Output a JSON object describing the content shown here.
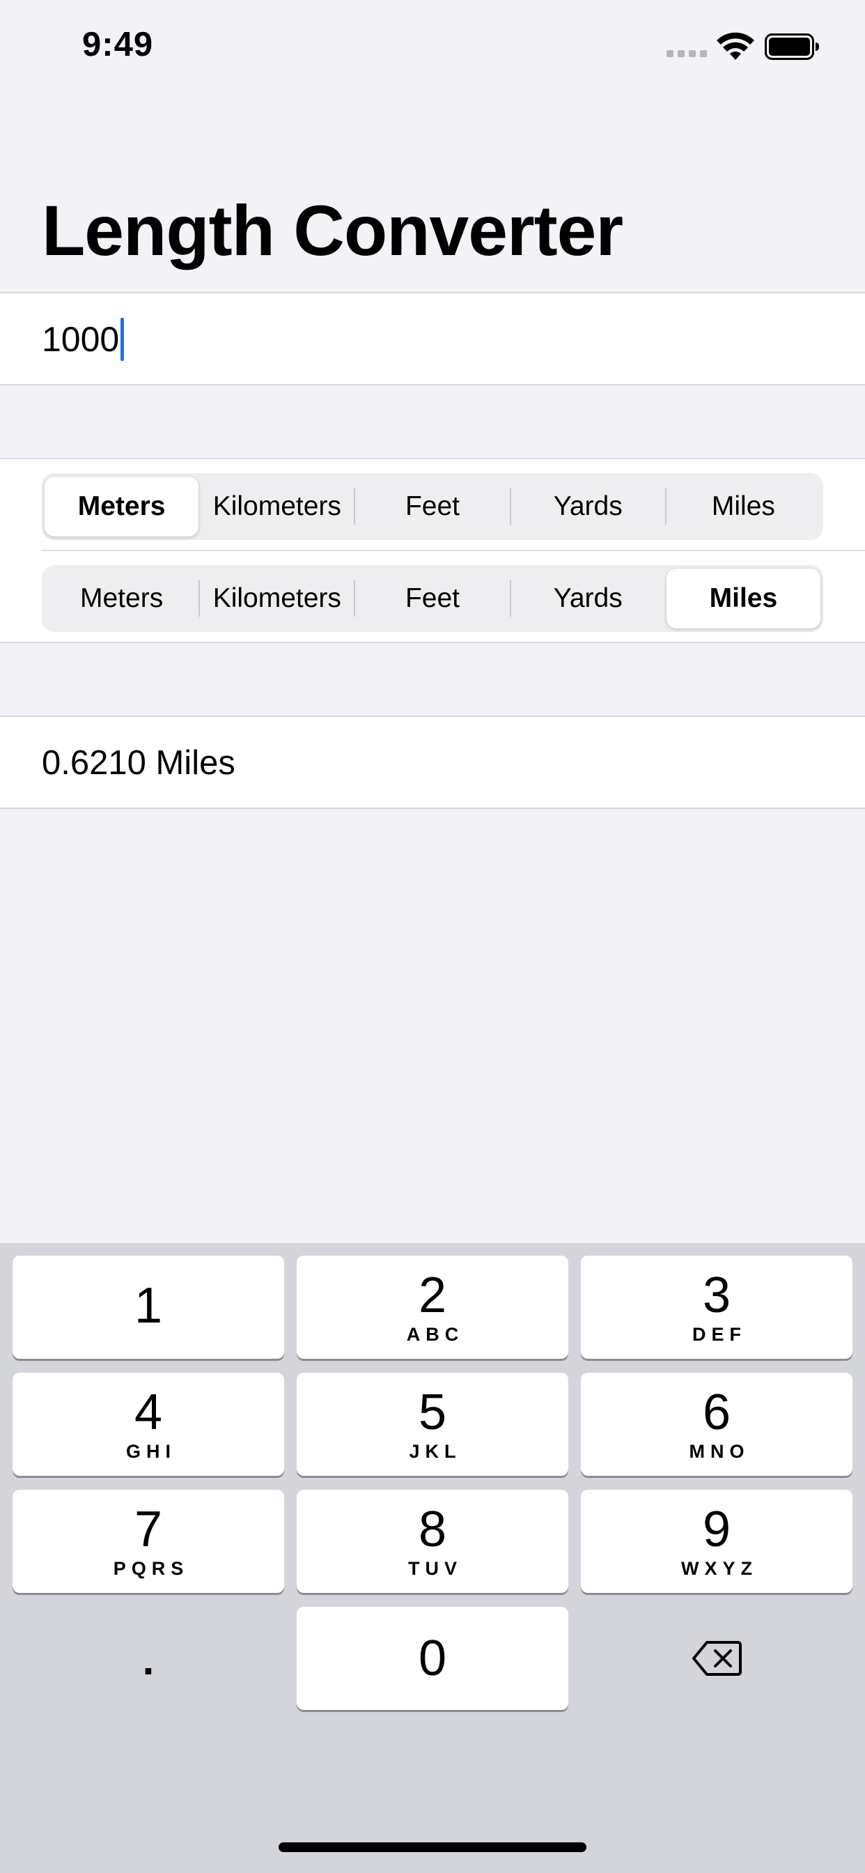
{
  "status_bar": {
    "time": "9:49",
    "icons": [
      "signal-icon",
      "wifi-icon",
      "battery-icon"
    ]
  },
  "title": "Length Converter",
  "input": {
    "value": "1000"
  },
  "from_units": {
    "options": [
      "Meters",
      "Kilometers",
      "Feet",
      "Yards",
      "Miles"
    ],
    "selected": "Meters"
  },
  "to_units": {
    "options": [
      "Meters",
      "Kilometers",
      "Feet",
      "Yards",
      "Miles"
    ],
    "selected": "Miles"
  },
  "result": "0.6210 Miles",
  "keyboard": {
    "keys": [
      {
        "digit": "1",
        "letters": ""
      },
      {
        "digit": "2",
        "letters": "ABC"
      },
      {
        "digit": "3",
        "letters": "DEF"
      },
      {
        "digit": "4",
        "letters": "GHI"
      },
      {
        "digit": "5",
        "letters": "JKL"
      },
      {
        "digit": "6",
        "letters": "MNO"
      },
      {
        "digit": "7",
        "letters": "PQRS"
      },
      {
        "digit": "8",
        "letters": "TUV"
      },
      {
        "digit": "9",
        "letters": "WXYZ"
      },
      {
        "digit": "0",
        "letters": ""
      }
    ],
    "decimal": ".",
    "delete_icon": "backspace-icon"
  },
  "colors": {
    "background": "#f2f2f7",
    "keyboard_background": "#d3d5db",
    "caret": "#1a73e8"
  }
}
